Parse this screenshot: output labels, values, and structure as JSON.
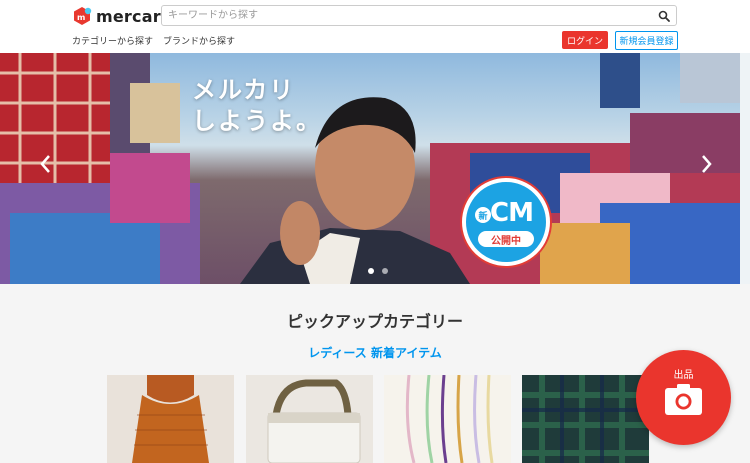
{
  "header": {
    "logo_text": "mercari",
    "search_placeholder": "キーワードから探す",
    "nav": [
      "カテゴリーから探す",
      "ブランドから探す"
    ],
    "login_label": "ログイン",
    "register_label": "新規会員登録"
  },
  "hero": {
    "copy": "メルカリ\nしようよ。",
    "badge_new": "新",
    "badge_main": "CM",
    "badge_sub": "公開中",
    "slides_count": 2,
    "active_slide": 1
  },
  "pickup": {
    "title": "ピックアップカテゴリー",
    "subtitle": "レディース 新着アイテム"
  },
  "fab": {
    "label": "出品"
  },
  "colors": {
    "brand_red": "#ea352d",
    "link_blue": "#0095ee",
    "badge_blue": "#1ca3e3"
  }
}
